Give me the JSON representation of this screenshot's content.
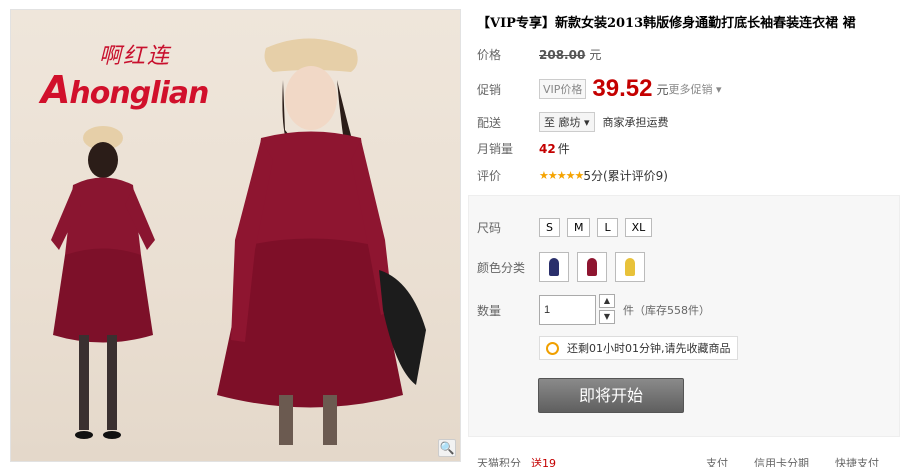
{
  "brand": {
    "cn": "啊红连",
    "en_initial": "A",
    "en_rest": "honglian"
  },
  "product": {
    "title": "【VIP专享】新款女装2013韩版修身通勤打底长袖春装连衣裙 裙"
  },
  "price_row": {
    "label": "价格",
    "original": "208.00",
    "unit": "元"
  },
  "promo_row": {
    "label": "促销",
    "tag": "VIP价格",
    "price": "39.52",
    "unit": "元",
    "more": "更多促销"
  },
  "delivery_row": {
    "label": "配送",
    "location": "至 廊坊",
    "note": "商家承担运费"
  },
  "sales_row": {
    "label": "月销量",
    "count": "42",
    "unit": "件"
  },
  "rating_row": {
    "label": "评价",
    "stars": "★★★★★",
    "text": "5分(累计评价9)"
  },
  "size_row": {
    "label": "尺码",
    "options": [
      "S",
      "M",
      "L",
      "XL"
    ]
  },
  "color_row": {
    "label": "颜色分类",
    "swatches": [
      "#2a2f6b",
      "#8e1530",
      "#e8c23a"
    ]
  },
  "qty_row": {
    "label": "数量",
    "value": "1",
    "stock": "件（库存558件）"
  },
  "tip": {
    "text": "还剩01小时01分钟,请先收藏商品"
  },
  "start_button": "即将开始",
  "footer": {
    "points_label": "天猫积分",
    "points_value": "送19",
    "pay_label": "支付",
    "credit": "信用卡分期",
    "quick": "快捷支付"
  }
}
